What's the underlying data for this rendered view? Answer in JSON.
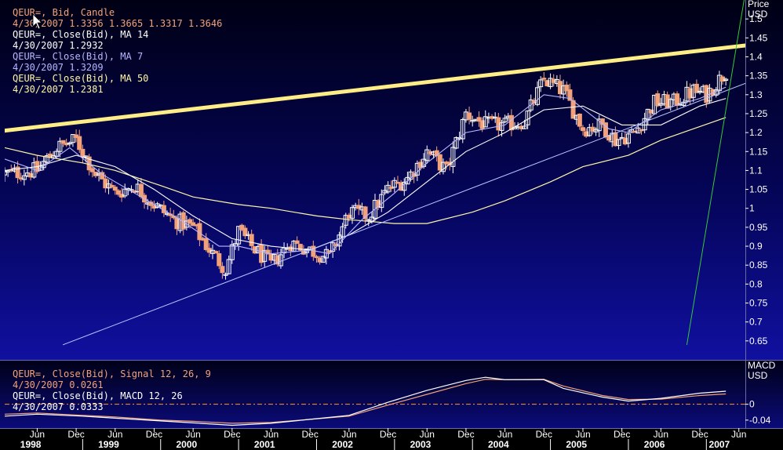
{
  "colors": {
    "background_top": "#000014",
    "background_bottom": "#10108a",
    "candle_up": "#ffffff",
    "candle_down": "#f2a27a",
    "ma14": "#ffffff",
    "ma7": "#b8b8ff",
    "ma50": "#fff7a8",
    "trendline_resistance": "#ffee88",
    "trendline_support": "#b8c8ff",
    "trendline_steep": "#33cc33",
    "signal_line": "#f2a27a",
    "macd_line": "#ffffff",
    "zero_line": "#ff9933",
    "text_orange": "#f2a27a",
    "text_white": "#ffffff",
    "text_lavender": "#b8b8ff",
    "text_yellow": "#fff7a8"
  },
  "legend": {
    "candle_title": "QEUR=, Bid, Candle",
    "candle_values": "4/30/2007 1.3356 1.3665 1.3317 1.3646",
    "ma14_title": "QEUR=, Close(Bid), MA 14",
    "ma14_value": "4/30/2007 1.2932",
    "ma7_title": "QEUR=, Close(Bid), MA  7",
    "ma7_value": "4/30/2007 1.3209",
    "ma50_title": "QEUR=, Close(Bid), MA 50",
    "ma50_value": "4/30/2007 1.2381"
  },
  "macd_legend": {
    "signal_title": "QEUR=, Close(Bid), Signal 12, 26, 9",
    "signal_value": "4/30/2007 0.0261",
    "macd_title": "QEUR=, Close(Bid), MACD 12, 26",
    "macd_value": "4/30/2007 0.0333"
  },
  "axis": {
    "price_label": "Price",
    "price_unit": "USD",
    "macd_label": "MACD",
    "macd_unit": "USD"
  },
  "chart_data": {
    "type": "candlestick",
    "x_range": [
      "1998-01",
      "2007-07"
    ],
    "price_ylim": [
      0.6,
      1.55
    ],
    "price_ticks": [
      "1.5",
      "1.45",
      "1.4",
      "1.35",
      "1.3",
      "1.25",
      "1.2",
      "1.15",
      "1.1",
      "1.05",
      "1",
      "0.95",
      "0.9",
      "0.85",
      "0.8",
      "0.75",
      "0.7",
      "0.65"
    ],
    "macd_ticks": [
      "0",
      "-0.04"
    ],
    "macd_ylim": [
      -0.06,
      0.11
    ],
    "month_ticks": [
      {
        "label": "Jun",
        "date": "1998-06"
      },
      {
        "label": "Dec",
        "date": "1998-12"
      },
      {
        "label": "Jun",
        "date": "1999-06"
      },
      {
        "label": "Dec",
        "date": "1999-12"
      },
      {
        "label": "Jun",
        "date": "2000-06"
      },
      {
        "label": "Dec",
        "date": "2000-12"
      },
      {
        "label": "Jun",
        "date": "2001-06"
      },
      {
        "label": "Dec",
        "date": "2001-12"
      },
      {
        "label": "Jun",
        "date": "2002-06"
      },
      {
        "label": "Dec",
        "date": "2002-12"
      },
      {
        "label": "Jun",
        "date": "2003-06"
      },
      {
        "label": "Dec",
        "date": "2003-12"
      },
      {
        "label": "Jun",
        "date": "2004-06"
      },
      {
        "label": "Dec",
        "date": "2004-12"
      },
      {
        "label": "Jun",
        "date": "2005-06"
      },
      {
        "label": "Dec",
        "date": "2005-12"
      },
      {
        "label": "Jun",
        "date": "2006-06"
      },
      {
        "label": "Dec",
        "date": "2006-12"
      },
      {
        "label": "Jun",
        "date": "2007-06"
      }
    ],
    "year_ticks": [
      {
        "label": "1998",
        "date": "1998-05"
      },
      {
        "label": "1999",
        "date": "1999-05"
      },
      {
        "label": "2000",
        "date": "2000-05"
      },
      {
        "label": "2001",
        "date": "2001-05"
      },
      {
        "label": "2002",
        "date": "2002-05"
      },
      {
        "label": "2003",
        "date": "2003-05"
      },
      {
        "label": "2004",
        "date": "2004-05"
      },
      {
        "label": "2005",
        "date": "2005-05"
      },
      {
        "label": "2006",
        "date": "2006-05"
      },
      {
        "label": "2007",
        "date": "2007-03"
      }
    ],
    "close_path": [
      [
        "1998-01",
        1.09
      ],
      [
        "1998-06",
        1.1
      ],
      [
        "1998-09",
        1.16
      ],
      [
        "1998-12",
        1.18
      ],
      [
        "1999-03",
        1.09
      ],
      [
        "1999-06",
        1.04
      ],
      [
        "1999-09",
        1.06
      ],
      [
        "1999-12",
        1.01
      ],
      [
        "2000-03",
        0.97
      ],
      [
        "2000-06",
        0.95
      ],
      [
        "2000-09",
        0.88
      ],
      [
        "2000-11",
        0.84
      ],
      [
        "2001-01",
        0.94
      ],
      [
        "2001-03",
        0.9
      ],
      [
        "2001-06",
        0.85
      ],
      [
        "2001-09",
        0.91
      ],
      [
        "2001-12",
        0.89
      ],
      [
        "2002-03",
        0.87
      ],
      [
        "2002-06",
        0.99
      ],
      [
        "2002-09",
        0.98
      ],
      [
        "2002-12",
        1.05
      ],
      [
        "2003-03",
        1.08
      ],
      [
        "2003-06",
        1.15
      ],
      [
        "2003-09",
        1.1
      ],
      [
        "2003-12",
        1.25
      ],
      [
        "2004-03",
        1.22
      ],
      [
        "2004-06",
        1.22
      ],
      [
        "2004-09",
        1.23
      ],
      [
        "2004-12",
        1.34
      ],
      [
        "2005-03",
        1.31
      ],
      [
        "2005-06",
        1.21
      ],
      [
        "2005-09",
        1.22
      ],
      [
        "2005-11",
        1.18
      ],
      [
        "2006-02",
        1.2
      ],
      [
        "2006-05",
        1.28
      ],
      [
        "2006-08",
        1.28
      ],
      [
        "2006-11",
        1.31
      ],
      [
        "2007-01",
        1.3
      ],
      [
        "2007-04",
        1.36
      ]
    ],
    "ma7_path": [
      [
        "1998-01",
        1.13
      ],
      [
        "1998-06",
        1.1
      ],
      [
        "1998-11",
        1.16
      ],
      [
        "1999-04",
        1.09
      ],
      [
        "1999-10",
        1.03
      ],
      [
        "2000-04",
        0.97
      ],
      [
        "2000-10",
        0.9
      ],
      [
        "2001-01",
        0.9
      ],
      [
        "2001-06",
        0.88
      ],
      [
        "2001-12",
        0.89
      ],
      [
        "2002-03",
        0.88
      ],
      [
        "2002-08",
        0.97
      ],
      [
        "2003-01",
        1.04
      ],
      [
        "2003-06",
        1.12
      ],
      [
        "2003-12",
        1.2
      ],
      [
        "2004-06",
        1.22
      ],
      [
        "2004-12",
        1.3
      ],
      [
        "2005-04",
        1.29
      ],
      [
        "2005-10",
        1.21
      ],
      [
        "2006-01",
        1.2
      ],
      [
        "2006-06",
        1.26
      ],
      [
        "2006-12",
        1.29
      ],
      [
        "2007-04",
        1.32
      ]
    ],
    "ma14_path": [
      [
        "1998-01",
        1.1
      ],
      [
        "1998-06",
        1.11
      ],
      [
        "1998-12",
        1.14
      ],
      [
        "1999-06",
        1.11
      ],
      [
        "1999-12",
        1.05
      ],
      [
        "2000-06",
        0.98
      ],
      [
        "2000-12",
        0.92
      ],
      [
        "2001-06",
        0.9
      ],
      [
        "2001-12",
        0.89
      ],
      [
        "2002-06",
        0.93
      ],
      [
        "2002-12",
        0.99
      ],
      [
        "2003-06",
        1.07
      ],
      [
        "2003-12",
        1.15
      ],
      [
        "2004-06",
        1.2
      ],
      [
        "2004-12",
        1.26
      ],
      [
        "2005-06",
        1.27
      ],
      [
        "2005-12",
        1.22
      ],
      [
        "2006-06",
        1.22
      ],
      [
        "2006-12",
        1.27
      ],
      [
        "2007-04",
        1.29
      ]
    ],
    "ma50_path": [
      [
        "1998-01",
        1.16
      ],
      [
        "1998-06",
        1.14
      ],
      [
        "1999-01",
        1.12
      ],
      [
        "1999-06",
        1.1
      ],
      [
        "2000-01",
        1.06
      ],
      [
        "2000-06",
        1.03
      ],
      [
        "2001-01",
        1.01
      ],
      [
        "2001-06",
        1.0
      ],
      [
        "2002-01",
        0.98
      ],
      [
        "2002-06",
        0.97
      ],
      [
        "2003-01",
        0.96
      ],
      [
        "2003-06",
        0.96
      ],
      [
        "2004-01",
        0.99
      ],
      [
        "2004-06",
        1.02
      ],
      [
        "2005-01",
        1.07
      ],
      [
        "2005-06",
        1.11
      ],
      [
        "2006-01",
        1.14
      ],
      [
        "2006-06",
        1.18
      ],
      [
        "2007-04",
        1.24
      ]
    ],
    "trendlines": [
      {
        "name": "resistance",
        "from": [
          "1998-01",
          1.205
        ],
        "to": [
          "2007-07",
          1.43
        ]
      },
      {
        "name": "support",
        "from": [
          "1998-10",
          0.64
        ],
        "to": [
          "2007-07",
          1.33
        ]
      },
      {
        "name": "steep",
        "from": [
          "2006-10",
          0.64
        ],
        "to": [
          "2007-07",
          1.57
        ]
      }
    ],
    "macd_path": [
      [
        "1998-01",
        -0.03
      ],
      [
        "1998-06",
        -0.025
      ],
      [
        "1999-01",
        -0.03
      ],
      [
        "1999-06",
        -0.035
      ],
      [
        "2000-01",
        -0.042
      ],
      [
        "2000-06",
        -0.047
      ],
      [
        "2000-12",
        -0.053
      ],
      [
        "2001-06",
        -0.048
      ],
      [
        "2001-12",
        -0.038
      ],
      [
        "2002-06",
        -0.028
      ],
      [
        "2002-12",
        0.005
      ],
      [
        "2003-06",
        0.035
      ],
      [
        "2003-12",
        0.06
      ],
      [
        "2004-03",
        0.068
      ],
      [
        "2004-06",
        0.062
      ],
      [
        "2004-12",
        0.062
      ],
      [
        "2005-03",
        0.04
      ],
      [
        "2005-09",
        0.018
      ],
      [
        "2006-01",
        0.008
      ],
      [
        "2006-06",
        0.015
      ],
      [
        "2006-12",
        0.028
      ],
      [
        "2007-04",
        0.033
      ]
    ],
    "signal_path": [
      [
        "1998-01",
        -0.025
      ],
      [
        "1998-06",
        -0.022
      ],
      [
        "1999-01",
        -0.028
      ],
      [
        "1999-06",
        -0.032
      ],
      [
        "2000-01",
        -0.04
      ],
      [
        "2000-06",
        -0.043
      ],
      [
        "2000-12",
        -0.048
      ],
      [
        "2001-06",
        -0.046
      ],
      [
        "2001-12",
        -0.038
      ],
      [
        "2002-06",
        -0.03
      ],
      [
        "2002-12",
        -0.002
      ],
      [
        "2003-06",
        0.025
      ],
      [
        "2003-12",
        0.052
      ],
      [
        "2004-03",
        0.063
      ],
      [
        "2004-06",
        0.062
      ],
      [
        "2004-12",
        0.063
      ],
      [
        "2005-03",
        0.046
      ],
      [
        "2005-09",
        0.022
      ],
      [
        "2006-01",
        0.012
      ],
      [
        "2006-06",
        0.013
      ],
      [
        "2006-12",
        0.022
      ],
      [
        "2007-04",
        0.026
      ]
    ]
  }
}
